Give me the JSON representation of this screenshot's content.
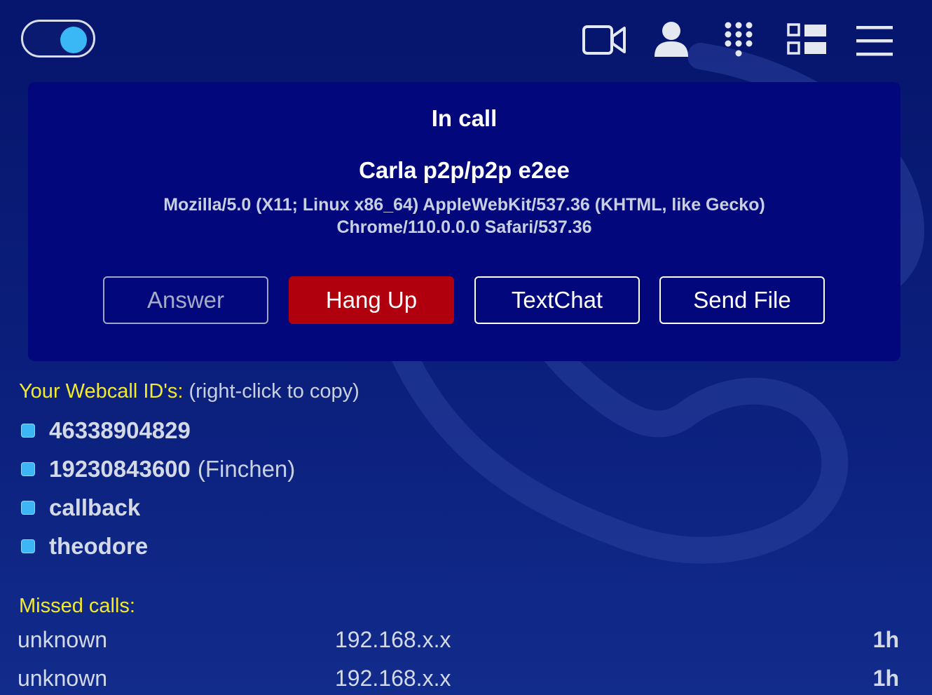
{
  "header": {
    "toggle_state": "on",
    "icons": [
      "video-camera-icon",
      "contacts-person-icon",
      "dialpad-icon",
      "dashboard-icon",
      "hamburger-menu-icon"
    ]
  },
  "call": {
    "title": "In call",
    "peer": "Carla p2p/p2p e2ee",
    "user_agent_line1": "Mozilla/5.0 (X11; Linux x86_64) AppleWebKit/537.36 (KHTML, like Gecko)",
    "user_agent_line2": "Chrome/110.0.0.0 Safari/537.36",
    "buttons": {
      "answer": "Answer",
      "hangup": "Hang Up",
      "textchat": "TextChat",
      "sendfile": "Send File"
    }
  },
  "ids": {
    "heading": "Your Webcall ID's:",
    "hint": "(right-click to copy)",
    "items": [
      {
        "id": "46338904829",
        "nickname": ""
      },
      {
        "id": "19230843600",
        "nickname": "(Finchen)"
      },
      {
        "id": "callback",
        "nickname": ""
      },
      {
        "id": "theodore",
        "nickname": ""
      }
    ]
  },
  "missed_calls": {
    "heading": "Missed calls:",
    "rows": [
      {
        "name": "unknown",
        "ip": "192.168.x.x",
        "age": "1h"
      },
      {
        "name": "unknown",
        "ip": "192.168.x.x",
        "age": "1h"
      }
    ]
  },
  "colors": {
    "background": "#0b1f7c",
    "panel": "#02087b",
    "hangup": "#b0000d",
    "accent": "#3cb6f4",
    "heading_yellow": "#f2ea2a"
  }
}
